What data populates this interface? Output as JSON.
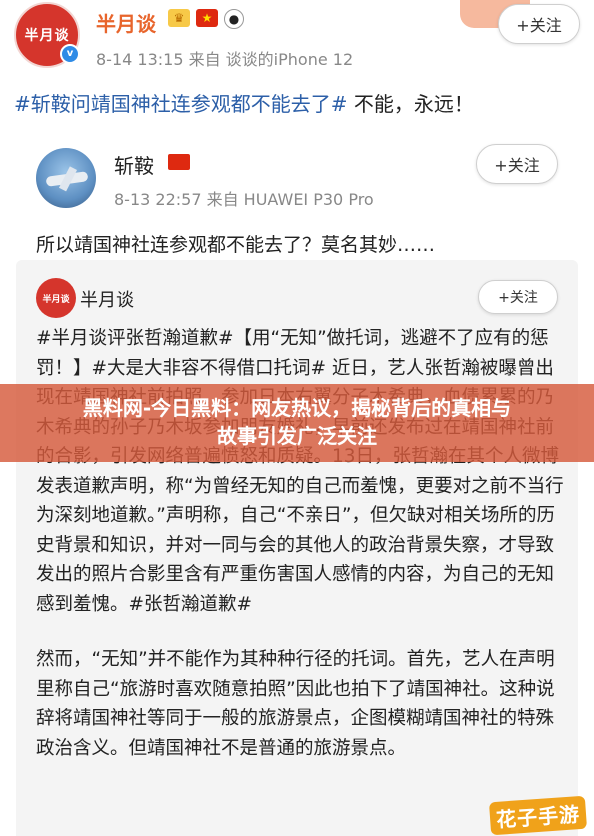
{
  "main_post": {
    "avatar_text": "半月谈",
    "author": "半月谈",
    "meta": "8-14 13:15  来自 谈谈的iPhone 12",
    "follow_label": "+关注",
    "topic": "#斩鞍问靖国神社连参观都不能去了#",
    "text": " 不能，永远！",
    "icons": [
      "crown-icon",
      "china-flag-icon",
      "panda-icon",
      "verified-icon"
    ]
  },
  "repost": {
    "author": "斩鞍",
    "meta": "8-13 22:57  来自 HUAWEI P30 Pro",
    "follow_label": "+关注",
    "text": "所以靖国神社连参观都不能去了？莫名其妙……"
  },
  "quoted_card": {
    "avatar_text": "半月谈",
    "author": "半月谈",
    "follow_label": "+关注",
    "paragraph1": "#半月谈评张哲瀚道歉#【用“无知”做托词，逃避不了应有的惩罚！】#大是大非容不得借口托词# 近日，艺人张哲瀚被曝曾出现在靖国神社前拍照、参加日本右翼分子木希典，血债累累的乃木希典的孙子乃木坂参加朋友婚礼，早前还发布过在靖国神社前的合影，引发网络普遍愤怒和质疑。13日，张哲瀚在其个人微博发表道歉声明，称“为曾经无知的自己而羞愧，更要对之前不当行为深刻地道歉。”声明称，自己“不亲日”，但欠缺对相关场所的历史背景和知识，并对一同与会的其他人的政治背景失察，才导致发出的照片合影里含有严重伤害国人感情的内容，为自己的无知感到羞愧。#张哲瀚道歉#",
    "paragraph2": "然而，“无知”并不能作为其种种行径的托词。首先，艺人在声明里称自己“旅游时喜欢随意拍照”因此也拍下了靖国神社。这种说辞将靖国神社等同于一般的旅游景点，企图模糊靖国神社的特殊政治含义。但靖国神社不是普通的旅游景点。"
  },
  "banner": {
    "line1": "黑料网-今日黑料：网友热议，揭秘背后的真相与",
    "line2": "故事引发广泛关注"
  },
  "watermark": "花子手游"
}
